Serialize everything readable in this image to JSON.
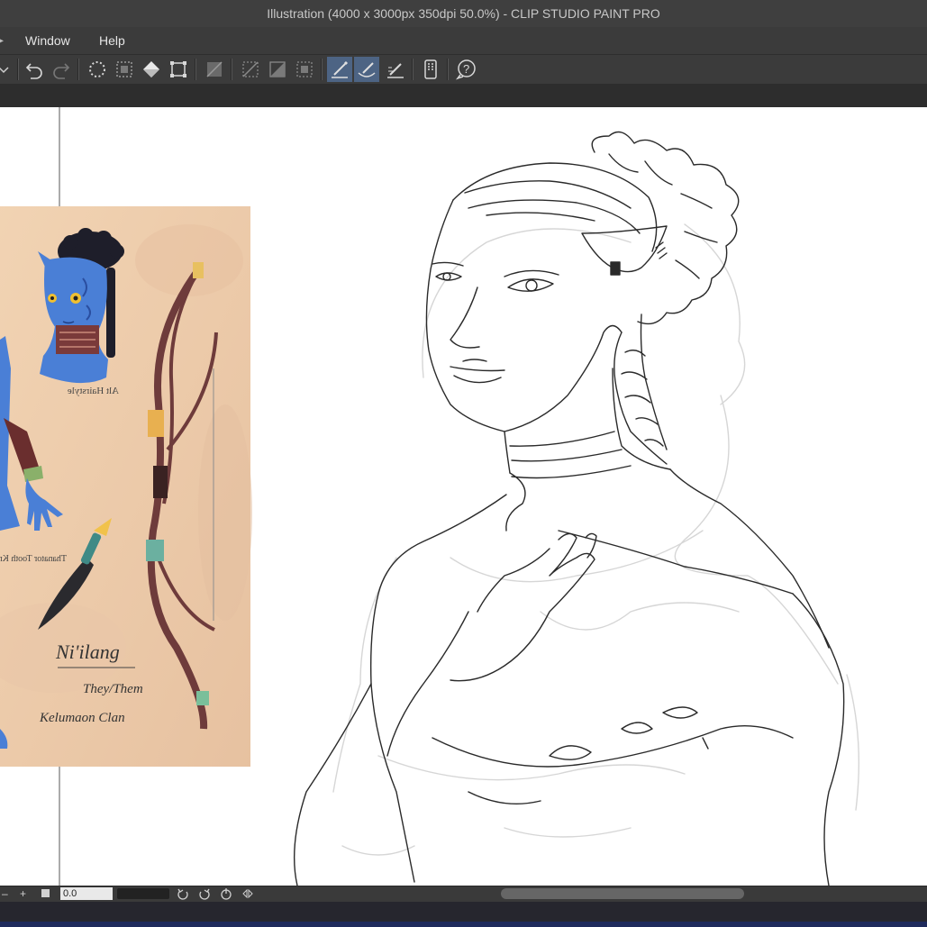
{
  "window": {
    "title": "Illustration (4000 x 3000px 350dpi 50.0%)  - CLIP STUDIO PAINT PRO"
  },
  "menu": {
    "items": [
      "Window",
      "Help"
    ]
  },
  "toolbar": {
    "icons": [
      "undo-icon",
      "redo-icon",
      "deselect-icon",
      "select-all-icon",
      "fill-icon",
      "transform-icon",
      "clear-icon",
      "clear-outside-icon",
      "fill-selection-icon",
      "convert-icon",
      "snap-ruler-icon",
      "snap-special-ruler-icon",
      "snap-grid-icon",
      "device-icon",
      "help-icon"
    ]
  },
  "statusbar": {
    "minus": "–",
    "plus": "+",
    "zoom_value": "0.0"
  },
  "reference": {
    "name_text": "Ni'ilang",
    "pronoun_text": "They/Them",
    "clan_text": "Kelumaon Clan",
    "alt_text": "Alt Hairstyle",
    "knife_text": "Thanator Tooth Knife"
  },
  "colors": {
    "title_bg": "#3f3f3f",
    "menu_bg": "#3b3b3b",
    "active_tool": "#4d6484",
    "ref_bg": "#efcfae",
    "skin_blue": "#4a7fd6",
    "bow_brown": "#6e3b3b"
  }
}
